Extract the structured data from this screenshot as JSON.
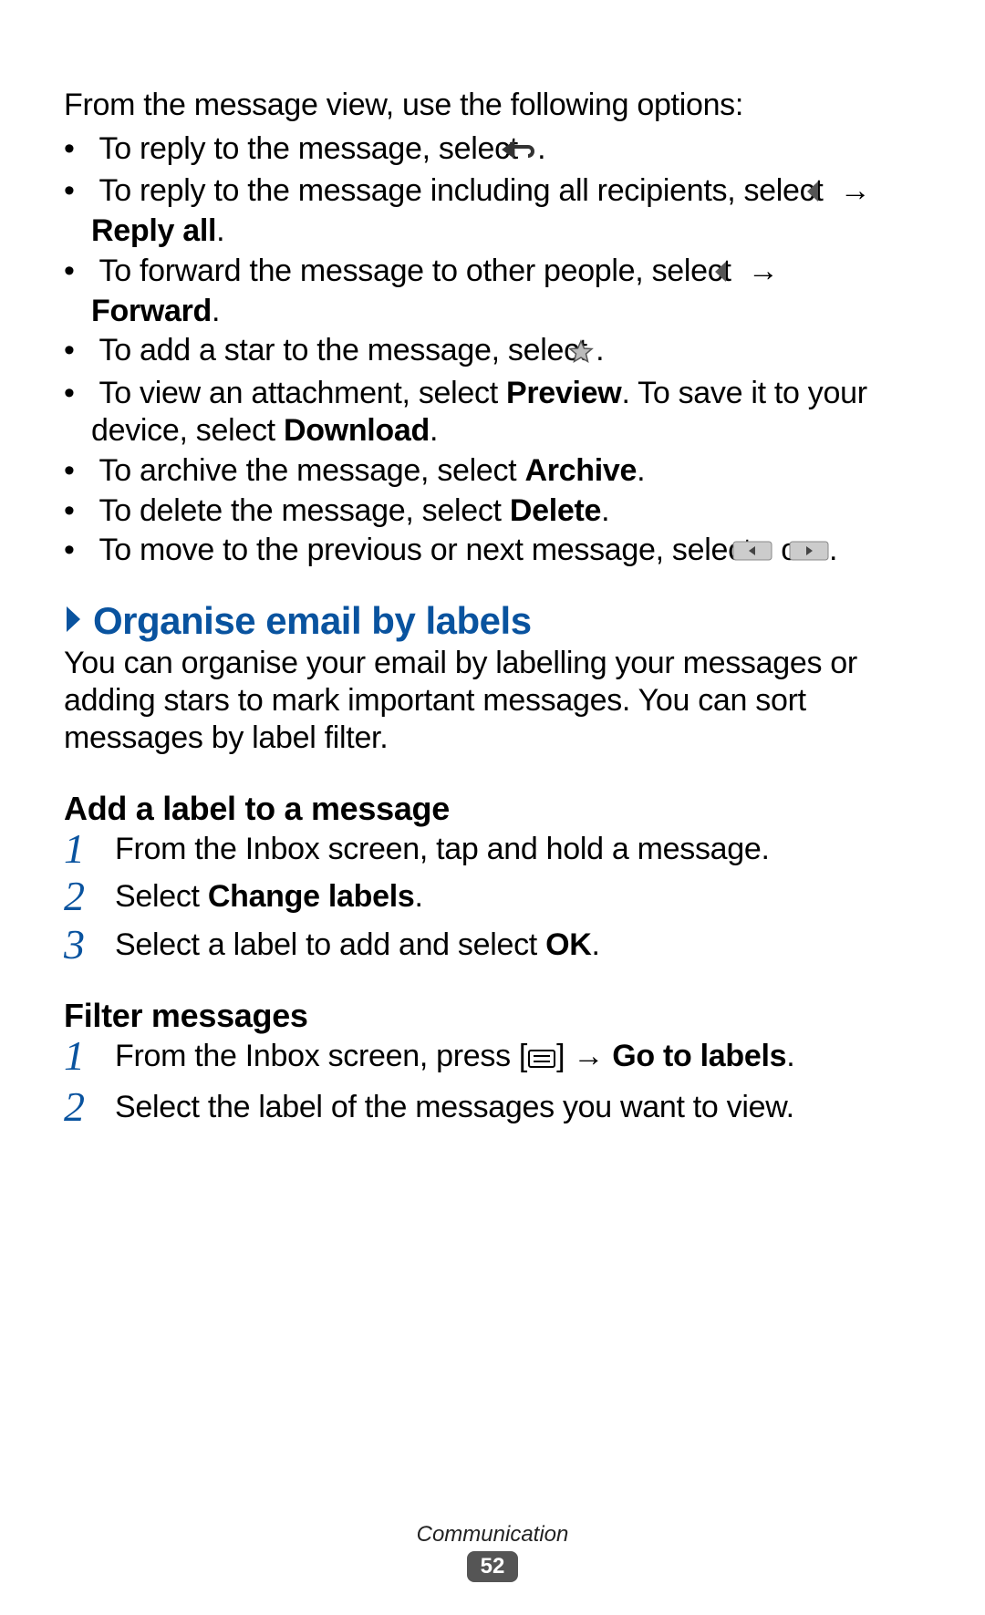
{
  "intro": "From the message view, use the following options:",
  "bullets": {
    "b1_a": "To reply to the message, select ",
    "b1_b": ".",
    "b2_a": "To reply to the message including all recipients, select ",
    "b2_arr": " → ",
    "b2_bold": "Reply all",
    "b2_b": ".",
    "b3_a": "To forward the message to other people, select ",
    "b3_arr": " → ",
    "b3_bold": "Forward",
    "b3_b": ".",
    "b4_a": "To add a star to the message, select ",
    "b4_b": ".",
    "b5_a": "To view an attachment, select ",
    "b5_bold1": "Preview",
    "b5_mid": ". To save it to your device, select ",
    "b5_bold2": "Download",
    "b5_b": ".",
    "b6_a": "To archive the message, select ",
    "b6_bold": "Archive",
    "b6_b": ".",
    "b7_a": "To delete the message, select ",
    "b7_bold": "Delete",
    "b7_b": ".",
    "b8_a": "To move to the previous or next message, select ",
    "b8_or": " or ",
    "b8_b": "."
  },
  "section": {
    "title": "Organise email by labels",
    "body": "You can organise your email by labelling your messages or adding stars to mark important messages. You can sort messages by label filter."
  },
  "sub1": {
    "title": "Add a label to a message",
    "s1": "From the Inbox screen, tap and hold a message.",
    "s2_a": "Select ",
    "s2_bold": "Change labels",
    "s2_b": ".",
    "s3_a": "Select a label to add and select ",
    "s3_bold": "OK",
    "s3_b": "."
  },
  "sub2": {
    "title": "Filter messages",
    "s1_a": "From the Inbox screen, press [",
    "s1_b": "] → ",
    "s1_bold": "Go to labels",
    "s1_c": ".",
    "s2": "Select the label of the messages you want to view."
  },
  "footer": {
    "section": "Communication",
    "page": "52"
  }
}
